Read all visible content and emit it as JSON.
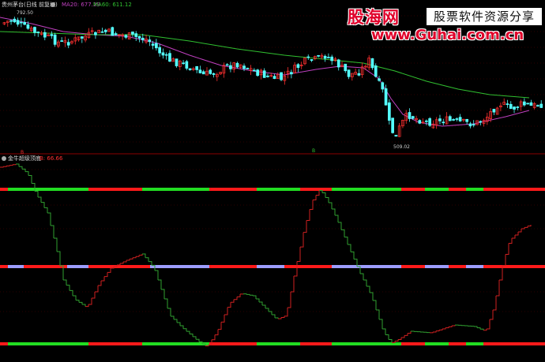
{
  "header": {
    "stock_title": "贵州茅台(日线 前复权)",
    "ma20_label": "MA20: 677.29",
    "ma60_label": "MA60: 611.12"
  },
  "price_chart": {
    "high_label": "792.50",
    "low_label": "509.02",
    "marker_label": "B"
  },
  "indicator": {
    "name": "金牛超级顶底",
    "value_label": "B: 66.66",
    "marker_label": "B"
  },
  "watermark": {
    "logo": "股海网",
    "slogan": "股票软件资源分享",
    "url": "www.Guhai.com.cn"
  },
  "colors": {
    "background": "#000000",
    "up_candle": "#ff3030",
    "down_candle": "#54ffff",
    "ma20": "#c040c0",
    "ma60": "#30c030",
    "osc_up": "#d02020",
    "osc_down": "#30a030",
    "band_red": "#ff1a1a",
    "band_green": "#22dd22",
    "band_lavender": "#9d9dff",
    "divider": "#8b0000"
  }
}
